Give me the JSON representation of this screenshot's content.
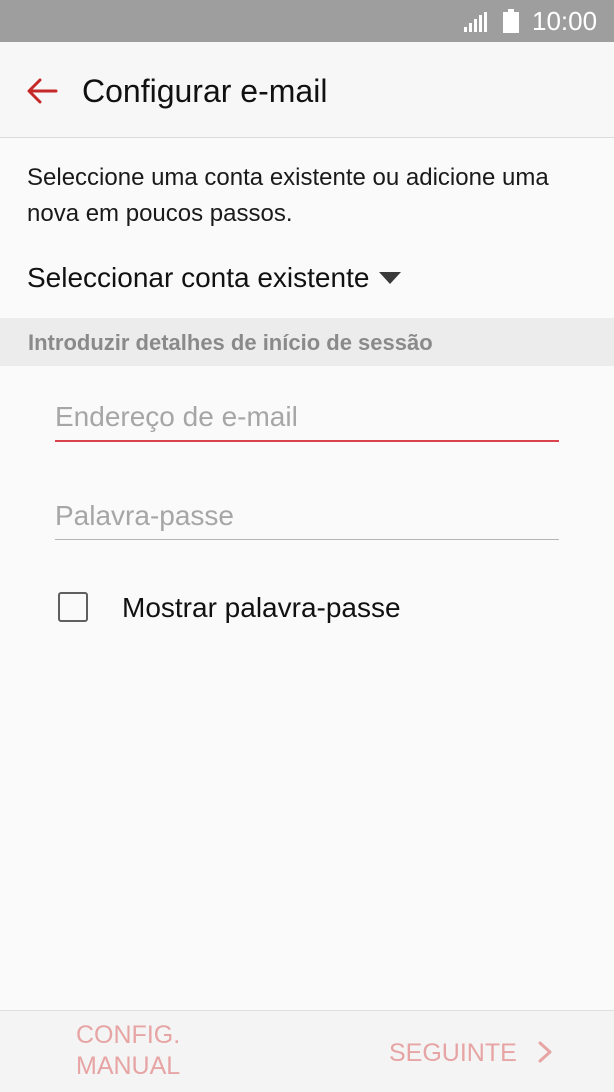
{
  "status_bar": {
    "time": "10:00",
    "icons": [
      "signal-icon",
      "battery-icon"
    ],
    "background": "#9e9e9e"
  },
  "app_bar": {
    "title": "Configurar e-mail",
    "back_icon": "back-arrow-icon",
    "accent": "#c62828"
  },
  "intro": {
    "text": "Seleccione uma conta existente ou adicione uma nova em poucos passos."
  },
  "account_select": {
    "label": "Seleccionar conta existente",
    "icon": "dropdown-triangle-icon"
  },
  "section": {
    "header": "Introduzir detalhes de início de sessão"
  },
  "form": {
    "email": {
      "placeholder": "Endereço de e-mail",
      "value": ""
    },
    "password": {
      "placeholder": "Palavra-passe",
      "value": ""
    },
    "show_password": {
      "label": "Mostrar palavra-passe",
      "checked": false
    }
  },
  "bottom_bar": {
    "manual_label": "CONFIG. MANUAL",
    "next_label": "SEGUINTE",
    "next_icon": "chevron-right-icon",
    "button_color": "#e7a4a4"
  }
}
